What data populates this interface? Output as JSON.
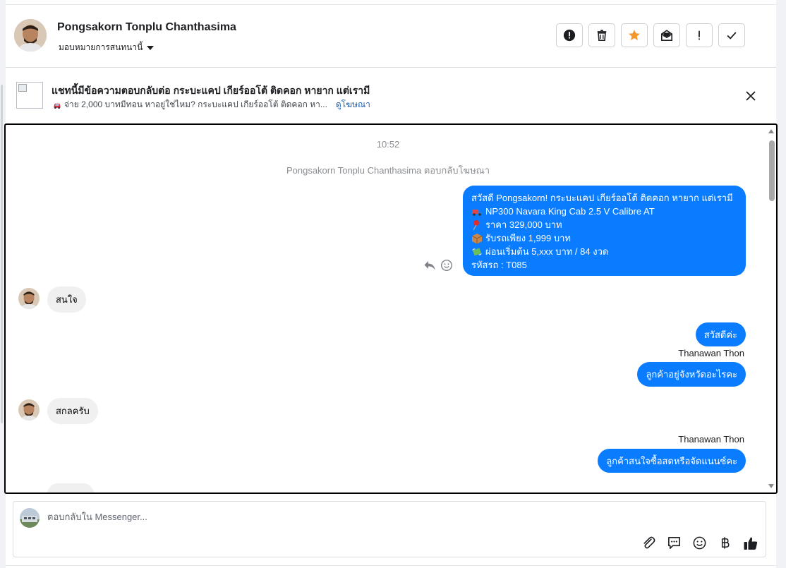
{
  "header": {
    "contact_name": "Pongsakorn Tonplu Chanthasima",
    "assign_label": "มอบหมายการสนทนานี้",
    "actions": [
      {
        "name": "report-button",
        "icon": "alert-circle-icon"
      },
      {
        "name": "delete-button",
        "icon": "trash-icon"
      },
      {
        "name": "star-button",
        "icon": "star-icon"
      },
      {
        "name": "mark-unread-button",
        "icon": "mail-open-icon"
      },
      {
        "name": "flag-important-button",
        "icon": "exclamation-icon"
      },
      {
        "name": "mark-done-button",
        "icon": "check-icon"
      }
    ]
  },
  "ad": {
    "title": "แชทนี้มีข้อความตอบกลับต่อ กระบะแคป เกียร์ออโต้ ติดคอก หายาก แต่เรามี",
    "subtitle": "จ่าย 2,000 บาทมีทอน หาอยู่ใช่ไหม? กระบะแคป เกียร์ออโต้ ติดคอก หา...",
    "link_label": "ดูโฆษณา"
  },
  "conversation": {
    "timestamp": "10:52",
    "system_note": "Pongsakorn Tonplu Chanthasima ตอบกลับโฆษณา",
    "ad_message": [
      {
        "icon": "",
        "text": "สวัสดี Pongsakorn! กระบะแคป เกียร์ออโต้ ติดคอก หายาก แต่เรามี"
      },
      {
        "icon": "truck-icon",
        "text": "NP300 Navara King Cab 2.5 V Calibre AT"
      },
      {
        "icon": "pin-icon",
        "text": "ราคา 329,000 บาท"
      },
      {
        "icon": "package-icon",
        "text": "รับรถเพียง 1,999 บาท"
      },
      {
        "icon": "money-wings-icon",
        "text": "ผ่อนเริ่มต้น 5,xxx บาท / 84 งวด"
      },
      {
        "icon": "",
        "text": "รหัสรถ : T085"
      }
    ],
    "incoming_1": "สนใจ",
    "outgoing_1": "สวัสดีค่ะ",
    "sender_1": "Thanawan Thon",
    "outgoing_2": "ลูกค้าอยู่จังหวัดอะไรคะ",
    "incoming_2": "สกลครับ",
    "sender_2": "Thanawan Thon",
    "outgoing_3": "ลูกค้าสนใจซื้อสดหรือจัดแนนซ์คะ"
  },
  "composer": {
    "placeholder": "ตอบกลับใน Messenger...",
    "tools": [
      "paperclip-icon",
      "chat-bubble-icon",
      "emoji-icon",
      "baht-icon",
      "thumbs-up-icon"
    ]
  },
  "colors": {
    "outgoing_bubble": "#0a7cff",
    "incoming_bubble": "#f0f0f0",
    "star": "#f5962a",
    "link": "#1a5fb4"
  }
}
